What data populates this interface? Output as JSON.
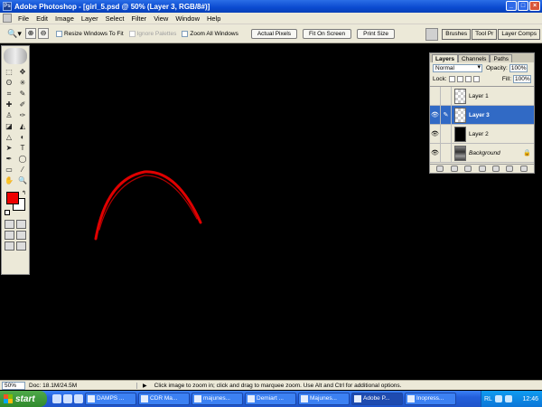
{
  "titlebar": {
    "app_icon": "Ps",
    "title": "Adobe Photoshop - [girl_5.psd @ 50% (Layer 3, RGB/8#)]",
    "controls": [
      "_",
      "□",
      "×"
    ]
  },
  "menu": [
    "File",
    "Edit",
    "Image",
    "Layer",
    "Select",
    "Filter",
    "View",
    "Window",
    "Help"
  ],
  "options": {
    "tool_icon": "zoom-tool-icon",
    "resize_windows": "Resize Windows To Fit",
    "ignore_palettes": "Ignore Palettes",
    "zoom_all_windows": "Zoom All Windows",
    "actual_pixels": "Actual Pixels",
    "fit_on_screen": "Fit On Screen",
    "print_size": "Print Size"
  },
  "palette_well": [
    "Brushes",
    "Tool Pr",
    "Layer Comps"
  ],
  "toolbox": {
    "foreground_color": "#ee0000",
    "background_color": "#ffffff"
  },
  "layers_palette": {
    "tabs": [
      "Layers",
      "Channels",
      "Paths"
    ],
    "blend_mode": "Normal",
    "opacity_label": "Opacity:",
    "opacity": "100%",
    "lock_label": "Lock:",
    "fill_label": "Fill:",
    "fill": "100%",
    "layers": [
      {
        "name": "Layer 1",
        "visible": false,
        "selected": false
      },
      {
        "name": "Layer 3",
        "visible": true,
        "selected": true
      },
      {
        "name": "Layer 2",
        "visible": true,
        "selected": false
      },
      {
        "name": "Background",
        "visible": true,
        "selected": false
      }
    ]
  },
  "status": {
    "zoom": "50%",
    "doc": "Doc: 18.1M/24.5M",
    "hint": "Click image to zoom in; click and drag to marquee zoom.  Use Alt and Ctrl for additional options."
  },
  "taskbar": {
    "start": "start",
    "tasks": [
      "DAMPS ...",
      "CDR Ma...",
      "majunes...",
      "Demiart ...",
      "Majunes...",
      "Adobe P...",
      "Inopress..."
    ],
    "active_task": 5,
    "lang": "RL",
    "clock": "12:46"
  },
  "canvas": {
    "background": "#000000",
    "stroke_color": "#e00000"
  }
}
